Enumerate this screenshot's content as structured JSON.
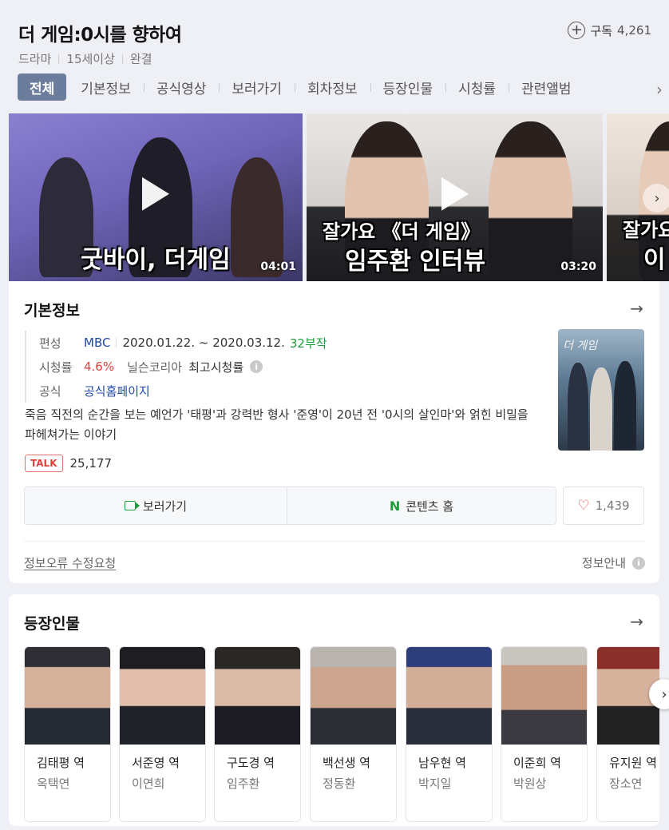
{
  "header": {
    "title": "더 게임:0시를 향하여",
    "meta": [
      "드라마",
      "15세이상",
      "완결"
    ],
    "subscribe_label": "구독",
    "subscribe_count": "4,261"
  },
  "tabs": [
    {
      "label": "전체",
      "active": true
    },
    {
      "label": "기본정보"
    },
    {
      "label": "공식영상"
    },
    {
      "label": "보러가기"
    },
    {
      "label": "회차정보"
    },
    {
      "label": "등장인물"
    },
    {
      "label": "시청률"
    },
    {
      "label": "관련앨범"
    }
  ],
  "videos": [
    {
      "caption": "굿바이, 더게임",
      "duration": "04:01"
    },
    {
      "caption_line1": "잘가요 《더 게임》",
      "caption_line2": "임주환 인터뷰",
      "duration": "03:20"
    },
    {
      "caption_line1": "잘가요",
      "caption_line2": "이"
    }
  ],
  "basic_info": {
    "title": "기본정보",
    "broadcast_label": "편성",
    "channel": "MBC",
    "period": "2020.01.22. ~ 2020.03.12.",
    "episodes": "32부작",
    "rating_label": "시청률",
    "rating_value": "4.6%",
    "rating_source": "닐슨코리아",
    "rating_type": "최고시청률",
    "official_label": "공식",
    "official_link": "공식홈페이지",
    "synopsis": "죽음 직전의 순간을 보는 예언가 '태평'과 강력반 형사 '준영'이 20년 전 '0시의 살인마'와 얽힌 비밀을 파헤쳐가는 이야기",
    "talk_badge": "TALK",
    "talk_count": "25,177",
    "watch_button": "보러가기",
    "contents_home_button": "콘텐츠 홈",
    "like_count": "1,439",
    "report_link": "정보오류 수정요청",
    "guide_label": "정보안내",
    "poster_title": "더 게임"
  },
  "cast_section": {
    "title": "등장인물",
    "members": [
      {
        "role": "김태평 역",
        "actor": "옥택연"
      },
      {
        "role": "서준영 역",
        "actor": "이연희"
      },
      {
        "role": "구도경 역",
        "actor": "임주환"
      },
      {
        "role": "백선생 역",
        "actor": "정동환"
      },
      {
        "role": "남우현 역",
        "actor": "박지일"
      },
      {
        "role": "이준희 역",
        "actor": "박원상"
      },
      {
        "role": "유지원 역",
        "actor": "장소연"
      }
    ]
  },
  "colors": {
    "active_tab": "#6b7c9d",
    "link_blue": "#1f4aa8",
    "green": "#1d9c3b",
    "red": "#e0403c"
  }
}
